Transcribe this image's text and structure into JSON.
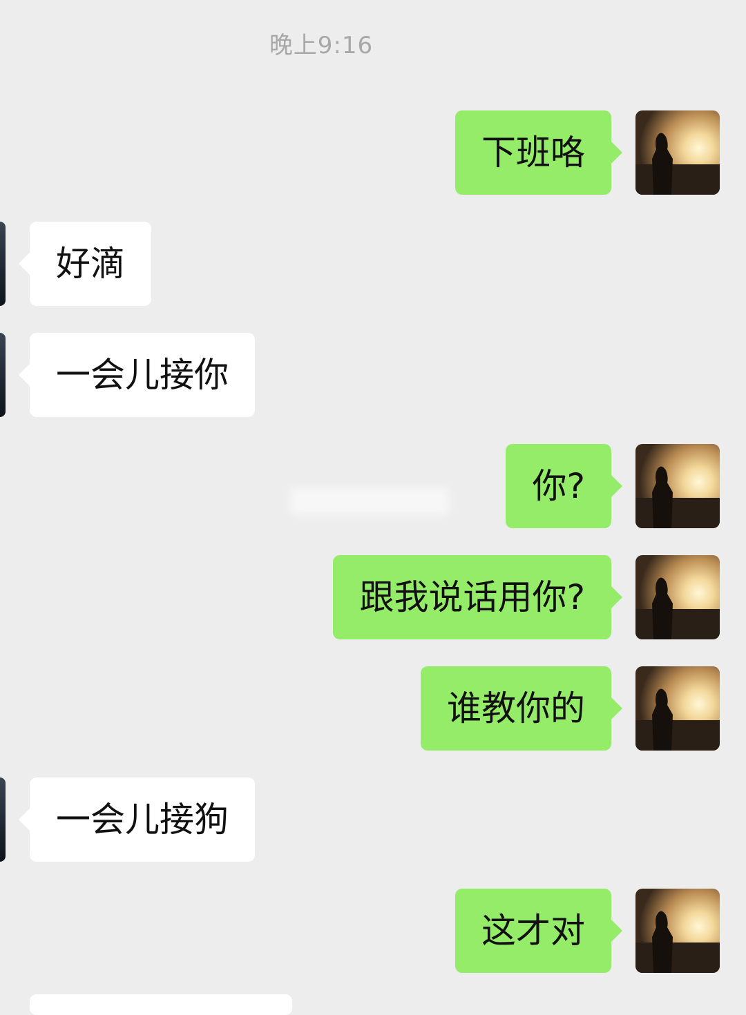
{
  "timestamp": "晚上9:16",
  "messages": [
    {
      "side": "out",
      "text": "下班咯"
    },
    {
      "side": "in",
      "text": "好滴"
    },
    {
      "side": "in",
      "text": "一会儿接你"
    },
    {
      "side": "out",
      "text": "你?"
    },
    {
      "side": "out",
      "text": "跟我说话用你?"
    },
    {
      "side": "out",
      "text": "谁教你的"
    },
    {
      "side": "in",
      "text": "一会儿接狗"
    },
    {
      "side": "out",
      "text": "这才对"
    }
  ],
  "colors": {
    "background": "#ededed",
    "outgoing_bubble": "#95ec69",
    "incoming_bubble": "#ffffff",
    "timestamp_text": "#a8a8a8"
  },
  "icons": {
    "self_avatar": "sunset-silhouette-avatar",
    "peer_avatar": "dark-landscape-avatar"
  }
}
